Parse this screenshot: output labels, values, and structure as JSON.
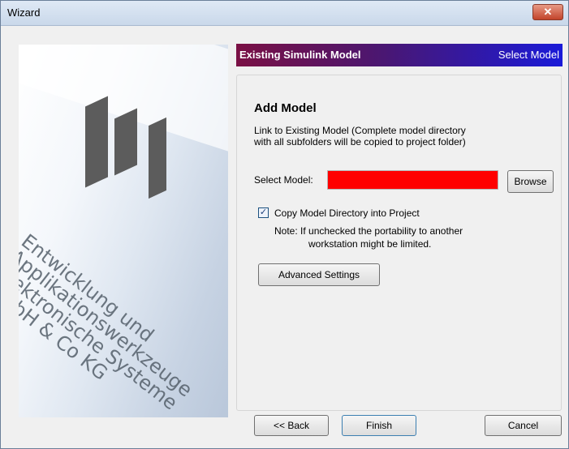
{
  "window": {
    "title": "Wizard",
    "close_glyph": "✕"
  },
  "side_image": {
    "text": "Entwicklung und\nApplikationswerkzeuge\nelektronische Systeme\nGmbH & Co KG"
  },
  "header": {
    "title": "Existing Simulink Model",
    "step": "Select Model"
  },
  "content": {
    "title": "Add Model",
    "description_line1": "Link to Existing Model (Complete model directory",
    "description_line2": "with all subfolders will be copied to project folder)",
    "select_model_label": "Select Model:",
    "select_model_value": "",
    "browse_label": "Browse",
    "copy_checkbox": {
      "label": "Copy Model Directory into Project",
      "checked": true,
      "check_glyph": "✓"
    },
    "note_line1": "Note:  If unchecked the portability to another",
    "note_line2": "workstation might be limited.",
    "advanced_settings_label": "Advanced Settings"
  },
  "footer": {
    "back_label": "<< Back",
    "finish_label": "Finish",
    "cancel_label": "Cancel"
  },
  "colors": {
    "header_start": "#7a1044",
    "header_end": "#1a1ad8",
    "select_field": "#ff0000"
  }
}
